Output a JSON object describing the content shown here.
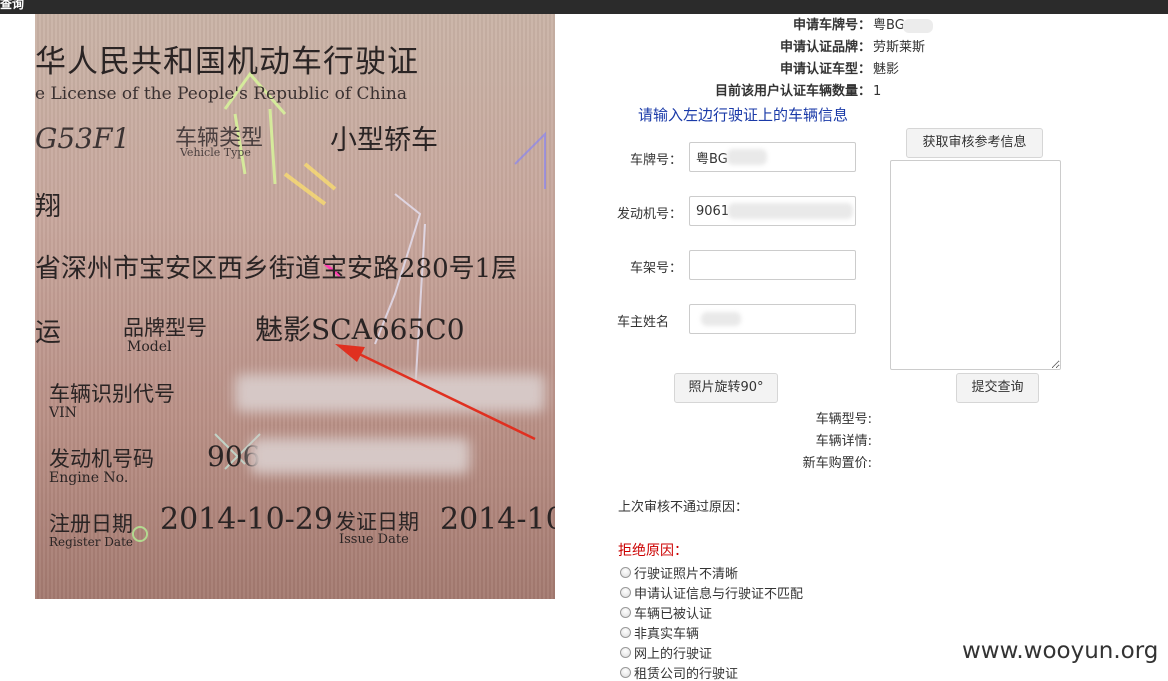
{
  "window": {
    "title": "查询"
  },
  "license_photo": {
    "title_cn": "华人民共和国机动车行驶证",
    "title_en": "e License of the People's Republic of China",
    "plate": "G53F1",
    "vehicle_type_cn": "车辆类型",
    "vehicle_type_en": "Vehicle Type",
    "vehicle_type_value": "小型轿车",
    "owner": "翔",
    "address": "省深州市宝安区西乡街道宝安路280号1层",
    "use": "运",
    "model_label_cn": "品牌型号",
    "model_label_en": "Model",
    "model_value": "魅影SCA665C0",
    "vin_label_cn": "车辆识别代号",
    "vin_label_en": "VIN",
    "engine_label_cn": "发动机号码",
    "engine_label_en": "Engine No.",
    "engine_value": "906",
    "register_label_cn": "注册日期",
    "register_label_en": "Register Date",
    "register_value": "2014-10-29",
    "issue_label_cn": "发证日期",
    "issue_label_en": "Issue Date",
    "issue_value": "2014-10"
  },
  "info": {
    "plate_label": "申请车牌号：",
    "plate_value": "粤BG",
    "brand_label": "申请认证品牌：",
    "brand_value": "劳斯莱斯",
    "model_label": "申请认证车型：",
    "model_value": "魅影",
    "count_label": "目前该用户认证车辆数量：",
    "count_value": "1"
  },
  "instruction": "请输入左边行驶证上的车辆信息",
  "form": {
    "plate_label": "车牌号：",
    "plate_value": "粤BG",
    "engine_label": "发动机号：",
    "engine_value": "9061",
    "frame_label": "车架号：",
    "frame_value": "",
    "owner_label": "车主姓名",
    "owner_value": ""
  },
  "buttons": {
    "get_reference": "获取审核参考信息",
    "rotate_photo": "照片旋转90°",
    "submit_query": "提交查询"
  },
  "results": {
    "vehicle_model_label": "车辆型号:",
    "vehicle_detail_label": "车辆详情:",
    "new_price_label": "新车购置价:"
  },
  "last_review": "上次审核不通过原因：",
  "reject": {
    "title": "拒绝原因：",
    "options": [
      "行驶证照片不清晰",
      "申请认证信息与行驶证不匹配",
      "车辆已被认证",
      "非真实车辆",
      "网上的行驶证",
      "租赁公司的行驶证"
    ]
  },
  "watermark": "www.wooyun.org",
  "colors": {
    "instruction": "#1a3aa8",
    "reject_title": "#cc0000",
    "topbar": "#2b2b2b"
  }
}
